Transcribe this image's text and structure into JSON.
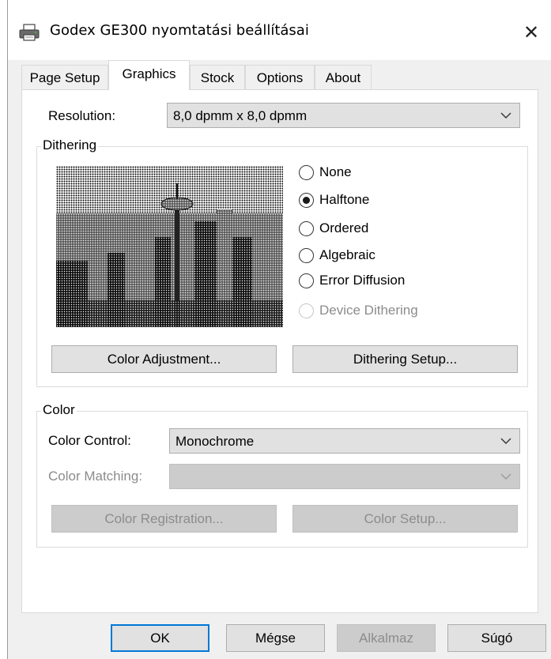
{
  "window": {
    "title": "Godex GE300 nyomtatási beállításai"
  },
  "tabs": [
    {
      "label": "Page Setup"
    },
    {
      "label": "Graphics"
    },
    {
      "label": "Stock"
    },
    {
      "label": "Options"
    },
    {
      "label": "About"
    }
  ],
  "active_tab": "Graphics",
  "resolution": {
    "label": "Resolution:",
    "value": "8,0 dpmm x 8,0 dpmm"
  },
  "dithering": {
    "group_title": "Dithering",
    "options": [
      {
        "label": "None",
        "checked": false,
        "enabled": true
      },
      {
        "label": "Halftone",
        "checked": true,
        "enabled": true
      },
      {
        "label": "Ordered",
        "checked": false,
        "enabled": true
      },
      {
        "label": "Algebraic",
        "checked": false,
        "enabled": true
      },
      {
        "label": "Error Diffusion",
        "checked": false,
        "enabled": true
      },
      {
        "label": "Device Dithering",
        "checked": false,
        "enabled": false
      }
    ],
    "color_adjustment_button": "Color Adjustment...",
    "dithering_setup_button": "Dithering Setup..."
  },
  "color": {
    "group_title": "Color",
    "color_control_label": "Color Control:",
    "color_control_value": "Monochrome",
    "color_matching_label": "Color Matching:",
    "color_matching_value": "",
    "color_registration_button": "Color Registration...",
    "color_setup_button": "Color Setup..."
  },
  "footer": {
    "ok": "OK",
    "cancel": "Mégse",
    "apply": "Alkalmaz",
    "help": "Súgó"
  },
  "colors": {
    "accent": "#0078d7",
    "disabled_text": "#8c8c8c"
  }
}
